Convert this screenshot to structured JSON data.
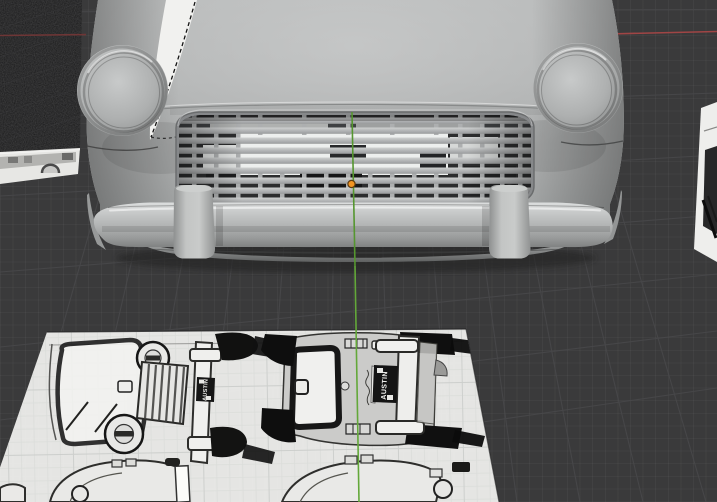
{
  "viewport": {
    "background_color": "#3a3a3b",
    "grid_major_color": "#48484a",
    "grid_minor_color": "#424244",
    "axis_x_color": "#a04545",
    "axis_z_color": "#63a839",
    "origin_dot_color": "#f29421"
  },
  "model": {
    "body_color": "#b0b2b2"
  },
  "reference_sheet": {
    "paper_color": "#f0f0ee",
    "front_plate_text": "AUSTIN",
    "rear_plate_text": "AUSTIN"
  },
  "side_reference": {
    "dark_color": "#171718"
  }
}
